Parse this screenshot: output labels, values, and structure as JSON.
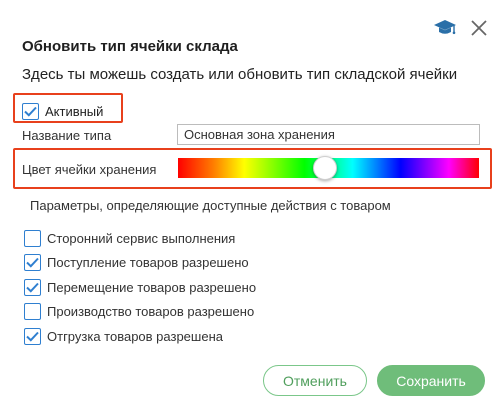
{
  "dialog": {
    "title": "Обновить тип ячейки склада",
    "subtitle": "Здесь ты можешь создать или обновить тип складской ячейки"
  },
  "icons": {
    "help": "graduation-cap-icon",
    "close": "close-icon"
  },
  "active": {
    "label": "Активный",
    "checked": true
  },
  "type_name": {
    "label": "Название типа",
    "value": "Основная зона хранения"
  },
  "cell_color": {
    "label": "Цвет ячейки хранения",
    "position_fraction": 0.485
  },
  "permissions": {
    "heading": "Параметры, определяющие доступные действия с товаром",
    "items": [
      {
        "label": "Сторонний сервис выполнения",
        "checked": false
      },
      {
        "label": "Поступление товаров разрешено",
        "checked": true
      },
      {
        "label": "Перемещение товаров разрешено",
        "checked": true
      },
      {
        "label": "Производство товаров разрешено",
        "checked": false
      },
      {
        "label": "Отгрузка товаров разрешена",
        "checked": true
      }
    ]
  },
  "buttons": {
    "cancel": "Отменить",
    "save": "Сохранить"
  },
  "colors": {
    "accent": "#2f7fd0",
    "highlight": "#e8401c",
    "save_bg": "#6fbd7a",
    "cancel_text": "#4f9e5c"
  }
}
